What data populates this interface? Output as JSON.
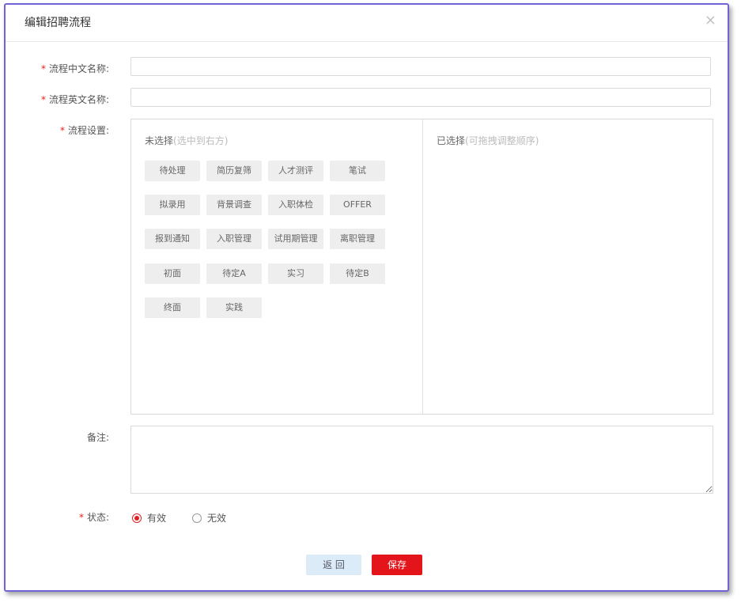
{
  "dialog": {
    "title": "编辑招聘流程",
    "close_glyph": "×"
  },
  "form": {
    "required_mark": "*",
    "name_cn_label": "流程中文名称:",
    "name_cn_value": "",
    "name_en_label": "流程英文名称:",
    "name_en_value": "",
    "process_label": "流程设置:",
    "remark_label": "备注:",
    "remark_value": "",
    "status_label": "状态:"
  },
  "process": {
    "unselected_title": "未选择",
    "unselected_hint": "(选中到右方)",
    "selected_title": "已选择",
    "selected_hint": "(可拖拽调整顺序)",
    "unselected_items": [
      "待处理",
      "简历复筛",
      "人才测评",
      "笔试",
      "拟录用",
      "背景调查",
      "入职体检",
      "OFFER",
      "报到通知",
      "入职管理",
      "试用期管理",
      "离职管理",
      "初面",
      "待定A",
      "实习",
      "待定B",
      "终面",
      "实践"
    ],
    "selected_items": []
  },
  "status": {
    "options": [
      {
        "label": "有效",
        "checked": true
      },
      {
        "label": "无效",
        "checked": false
      }
    ]
  },
  "buttons": {
    "back": "返 回",
    "save": "保存"
  },
  "colors": {
    "accent_red": "#e4141b",
    "frame_border": "#6f63d6",
    "back_button_bg": "#dcebf8"
  }
}
